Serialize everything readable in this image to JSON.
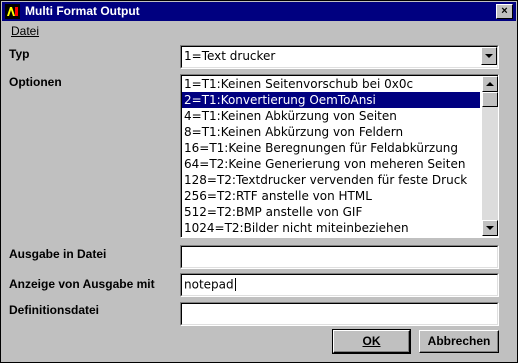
{
  "window": {
    "title": "Multi Format Output",
    "close_label": "×"
  },
  "menu": {
    "items": [
      {
        "label": "Datei"
      }
    ]
  },
  "typ": {
    "label": "Typ",
    "value": "1=Text drucker"
  },
  "optionen": {
    "label": "Optionen",
    "items": [
      "1=T1:Keinen Seitenvorschub bei 0x0c",
      "2=T1:Konvertierung OemToAnsi",
      "4=T1:Keinen Abkürzung von Seiten",
      "8=T1:Keinen Abkürzung von Feldern",
      "16=T1:Keine Beregnungen für Feldabkürzung",
      "64=T2:Keine Generierung von meheren Seiten",
      "128=T2:Textdrucker vervenden für feste Druck",
      "256=T2:RTF anstelle von HTML",
      "512=T2:BMP anstelle von GIF",
      "1024=T2:Bilder nicht miteinbeziehen"
    ],
    "selected_index": 1
  },
  "ausgabe_datei": {
    "label": "Ausgabe in Datei",
    "value": ""
  },
  "anzeige": {
    "label": "Anzeige von Ausgabe mit",
    "value": "notepad"
  },
  "definitionsdatei": {
    "label": "Definitionsdatei",
    "value": ""
  },
  "buttons": {
    "ok": "OK",
    "cancel": "Abbrechen"
  }
}
